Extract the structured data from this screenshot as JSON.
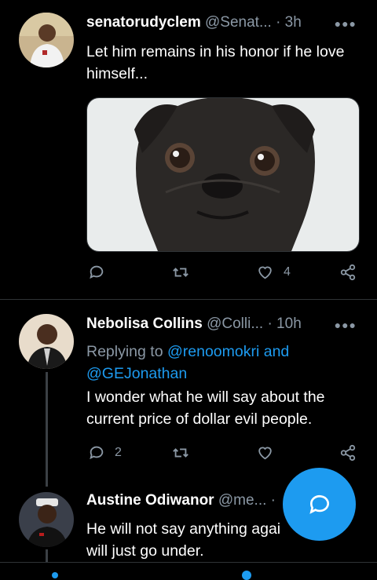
{
  "tweets": [
    {
      "display_name": "senatorudyclem",
      "handle": "@Senat...",
      "time": "· 3h",
      "text": "Let him remains in his honor if he love himself...",
      "has_image": true,
      "image_desc_icon": "pug-photo",
      "reply_count": "",
      "like_count": "4"
    },
    {
      "display_name": "Nebolisa Collins",
      "handle": "@Colli...",
      "time": "· 10h",
      "replying_prefix": "Replying to ",
      "replying_to_1": "@renoomokri and",
      "replying_to_2": "@GEJonathan",
      "text": "I wonder what he will say about the current price of dollar  evil people.",
      "reply_count": "2",
      "like_count": ""
    },
    {
      "display_name": "Austine Odiwanor",
      "handle": "@me...",
      "time": "·",
      "text_line1": "He will not say anything agai",
      "text_line2": "will just go under."
    }
  ],
  "more_icon": "more-options-icon",
  "compose_icon": "reply-bubble-icon",
  "colors": {
    "accent": "#1d9bf0",
    "muted": "#8b98a5",
    "background": "#000000"
  }
}
